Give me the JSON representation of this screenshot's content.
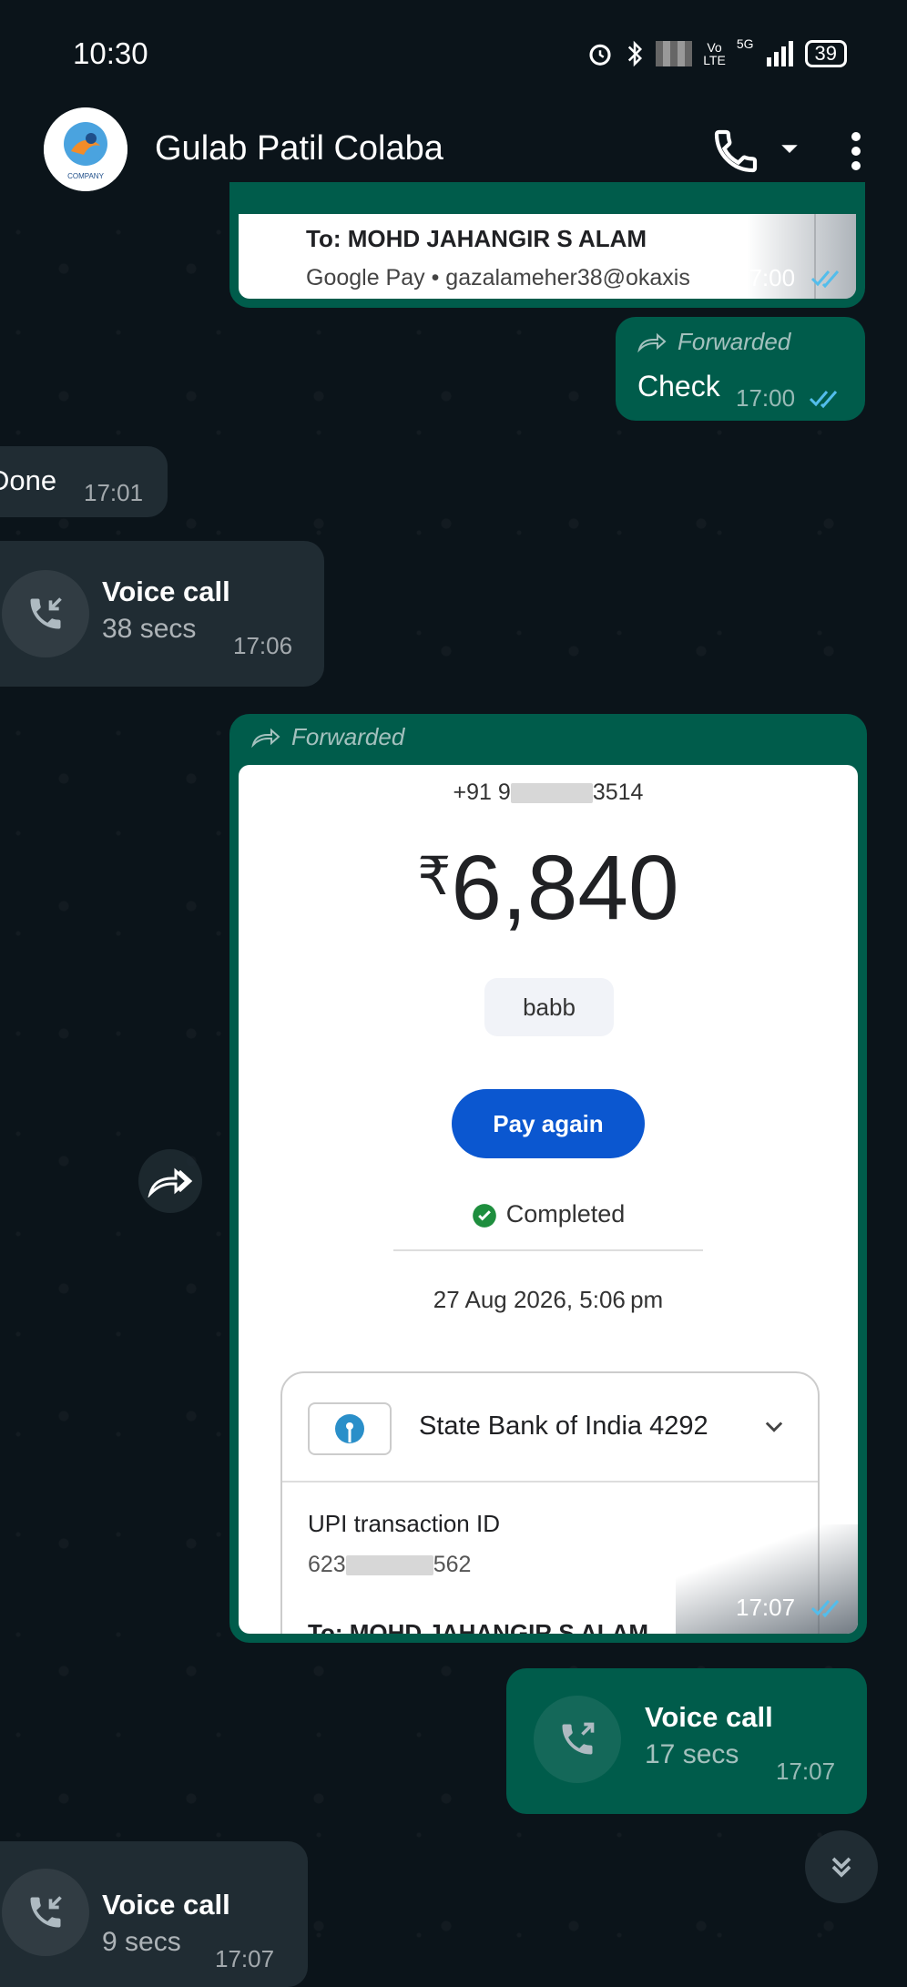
{
  "status_bar": {
    "time": "10:30",
    "battery": "39",
    "network": "5G"
  },
  "header": {
    "contact_name": "Gulab Patil Colaba",
    "avatar_caption": "COMPANY"
  },
  "messages": {
    "m1": {
      "to_line": "To: MOHD JAHANGIR S ALAM",
      "via_line": "Google Pay • gazalameher38@okaxis",
      "time": "17:00"
    },
    "m2": {
      "forwarded": "Forwarded",
      "text": "Check",
      "time": "17:00"
    },
    "m3": {
      "text": "Done",
      "time": "17:01"
    },
    "m4": {
      "title": "Voice call",
      "duration": "38 secs",
      "time": "17:06"
    },
    "m5": {
      "forwarded": "Forwarded",
      "phone_prefix": "+91 9",
      "phone_suffix": "3514",
      "currency": "₹",
      "amount": "6,840",
      "note": "babb",
      "pay_again": "Pay again",
      "status": "Completed",
      "datetime": "27 Aug 2026, 5:06 pm",
      "bank": "State Bank of India 4292",
      "upi_label": "UPI transaction ID",
      "upi_prefix": "623",
      "upi_suffix": "562",
      "to_line": "To: MOHD JAHANGIR S ALAM",
      "time": "17:07"
    },
    "m6": {
      "title": "Voice call",
      "duration": "17 secs",
      "time": "17:07"
    },
    "m7": {
      "title": "Voice call",
      "duration": "9 secs",
      "time": "17:07"
    }
  },
  "colors": {
    "outgoing": "#005c4b",
    "incoming": "#202c33",
    "background": "#0b141a",
    "accent_button": "#0b57d0",
    "tick_read": "#53bdeb"
  }
}
